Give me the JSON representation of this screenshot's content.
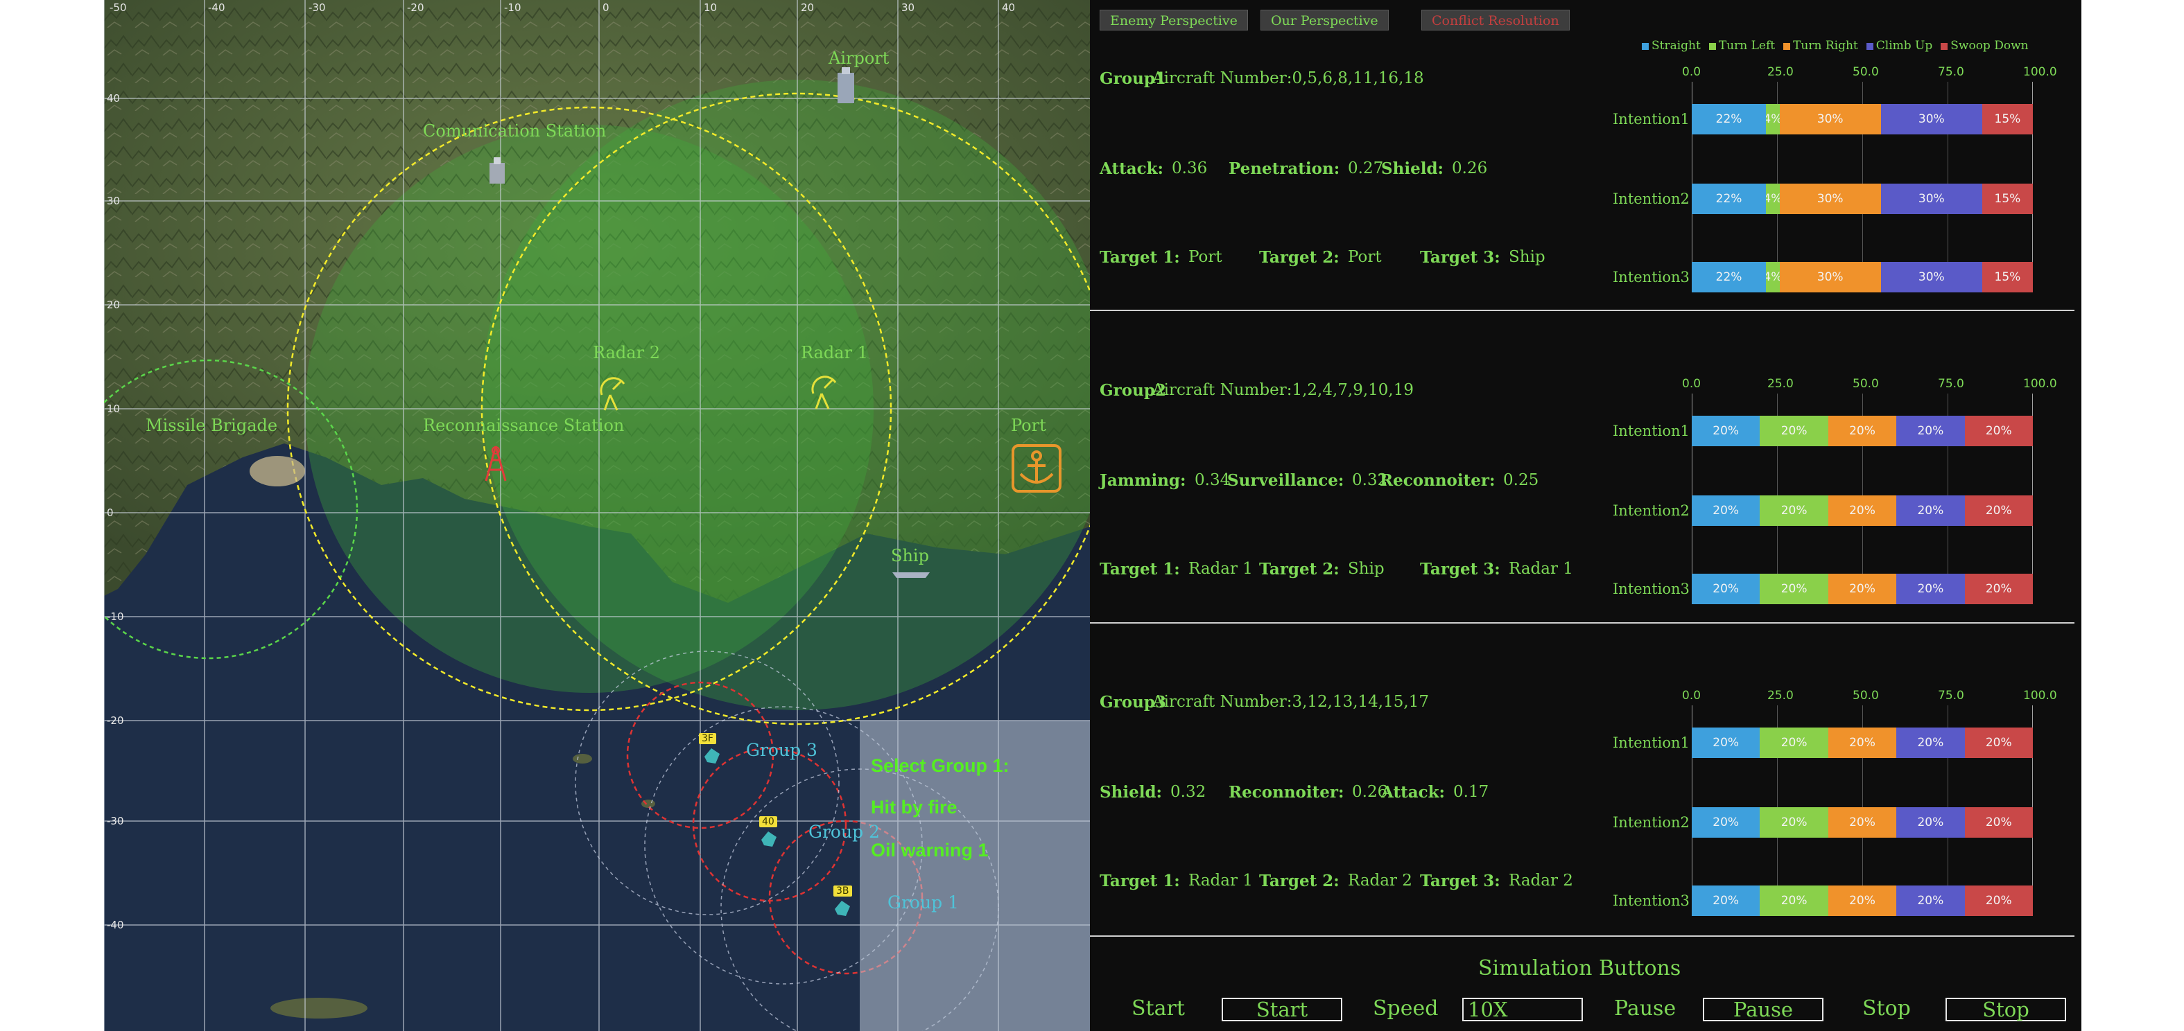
{
  "map": {
    "labels": {
      "airport": "Airport",
      "communication": "Comunication Station",
      "radar2": "Radar 2",
      "radar1": "Radar 1",
      "missile": "Missile Brigade",
      "recon": "Reconnaissance Station",
      "port": "Port",
      "ship": "Ship"
    },
    "top_ticks": [
      "-50",
      "-40",
      "-30",
      "-20",
      "-10",
      "0",
      "10",
      "20",
      "30",
      "40"
    ],
    "left_ticks": [
      "40",
      "30",
      "20",
      "10",
      "0",
      "-10",
      "-20",
      "-30",
      "-40"
    ],
    "groups": {
      "g3": "Group 3",
      "g2": "Group 2",
      "g1": "Group 1"
    },
    "badges": {
      "b3": "3F",
      "b2": "40",
      "b1": "3B"
    },
    "alert": {
      "line1": "Select Group 1:",
      "line2": "Hit by fire",
      "line3": "Oil warning 1"
    }
  },
  "panel": {
    "buttons": {
      "enemy": "Enemy Perspective",
      "ours": "Our Perspective",
      "conflict": "Conflict Resolution"
    },
    "legend": [
      {
        "label": "Straight",
        "color": "#3ea0dd"
      },
      {
        "label": "Turn Left",
        "color": "#8ad04a"
      },
      {
        "label": "Turn Right",
        "color": "#f0922b"
      },
      {
        "label": "Climb Up",
        "color": "#5a5ac8"
      },
      {
        "label": "Swoop Down",
        "color": "#c94848"
      }
    ],
    "axis_ticks": [
      "0.0",
      "25.0",
      "50.0",
      "75.0",
      "100.0"
    ],
    "groups": [
      {
        "name": "Group1",
        "aircraft": "Aircraft Number:0,5,6,8,11,16,18",
        "stats": [
          {
            "k": "Attack:",
            "v": "0.36"
          },
          {
            "k": "Penetration:",
            "v": "0.27"
          },
          {
            "k": "Shield:",
            "v": "0.26"
          }
        ],
        "targets": [
          {
            "k": "Target 1:",
            "v": "Port"
          },
          {
            "k": "Target 2:",
            "v": "Port"
          },
          {
            "k": "Target 3:",
            "v": "Ship"
          }
        ],
        "intentions": [
          {
            "label": "Intention1",
            "values": [
              22,
              4,
              30,
              30,
              15
            ],
            "text": [
              "22%",
              "4%",
              "30%",
              "30%",
              "15%"
            ]
          },
          {
            "label": "Intention2",
            "values": [
              22,
              4,
              30,
              30,
              15
            ],
            "text": [
              "22%",
              "4%",
              "30%",
              "30%",
              "15%"
            ]
          },
          {
            "label": "Intention3",
            "values": [
              22,
              4,
              30,
              30,
              15
            ],
            "text": [
              "22%",
              "4%",
              "30%",
              "30%",
              "15%"
            ]
          }
        ]
      },
      {
        "name": "Group2",
        "aircraft": "Aircraft Number:1,2,4,7,9,10,19",
        "stats": [
          {
            "k": "Jamming:",
            "v": "0.34"
          },
          {
            "k": "Surveillance:",
            "v": "0.32"
          },
          {
            "k": "Reconnoiter:",
            "v": "0.25"
          }
        ],
        "targets": [
          {
            "k": "Target 1:",
            "v": "Radar 1"
          },
          {
            "k": "Target 2:",
            "v": "Ship"
          },
          {
            "k": "Target 3:",
            "v": "Radar 1"
          }
        ],
        "intentions": [
          {
            "label": "Intention1",
            "values": [
              20,
              20,
              20,
              20,
              20
            ],
            "text": [
              "20%",
              "20%",
              "20%",
              "20%",
              "20%"
            ]
          },
          {
            "label": "Intention2",
            "values": [
              20,
              20,
              20,
              20,
              20
            ],
            "text": [
              "20%",
              "20%",
              "20%",
              "20%",
              "20%"
            ]
          },
          {
            "label": "Intention3",
            "values": [
              20,
              20,
              20,
              20,
              20
            ],
            "text": [
              "20%",
              "20%",
              "20%",
              "20%",
              "20%"
            ]
          }
        ]
      },
      {
        "name": "Group3",
        "aircraft": "Aircraft Number:3,12,13,14,15,17",
        "stats": [
          {
            "k": "Shield:",
            "v": "0.32"
          },
          {
            "k": "Reconnoiter:",
            "v": "0.26"
          },
          {
            "k": "Attack:",
            "v": "0.17"
          }
        ],
        "targets": [
          {
            "k": "Target 1:",
            "v": "Radar 1"
          },
          {
            "k": "Target 2:",
            "v": "Radar 2"
          },
          {
            "k": "Target 3:",
            "v": "Radar 2"
          }
        ],
        "intentions": [
          {
            "label": "Intention1",
            "values": [
              20,
              20,
              20,
              20,
              20
            ],
            "text": [
              "20%",
              "20%",
              "20%",
              "20%",
              "20%"
            ]
          },
          {
            "label": "Intention2",
            "values": [
              20,
              20,
              20,
              20,
              20
            ],
            "text": [
              "20%",
              "20%",
              "20%",
              "20%",
              "20%"
            ]
          },
          {
            "label": "Intention3",
            "values": [
              20,
              20,
              20,
              20,
              20
            ],
            "text": [
              "20%",
              "20%",
              "20%",
              "20%",
              "20%"
            ]
          }
        ]
      }
    ],
    "simulation": {
      "title": "Simulation Buttons",
      "start_label": "Start",
      "start_btn": "Start",
      "speed_label": "Speed",
      "speed_value": "10X",
      "pause_label": "Pause",
      "pause_btn": "Pause",
      "stop_label": "Stop",
      "stop_btn": "Stop"
    }
  },
  "colors": {
    "accent_green": "#7ed957",
    "conflict_red": "#c33f3f",
    "panel_bg": "#0d0d0d"
  }
}
